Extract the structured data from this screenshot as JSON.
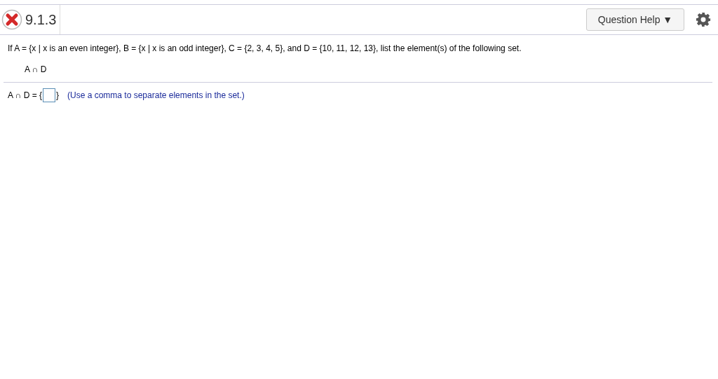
{
  "header": {
    "correct": false,
    "question_number": "9.1.3",
    "help_button": "Question Help ▼"
  },
  "question": {
    "text": "If A = {x | x is an even integer},  B = {x | x is an odd integer}, C = {2, 3, 4, 5}, and D = {10, 11, 12, 13}, list the element(s) of the following set.",
    "set_expression": "A ∩ D"
  },
  "answer": {
    "prefix": "A ∩ D = {",
    "suffix": "}",
    "hint": "(Use a comma to separate elements in the set.)"
  }
}
